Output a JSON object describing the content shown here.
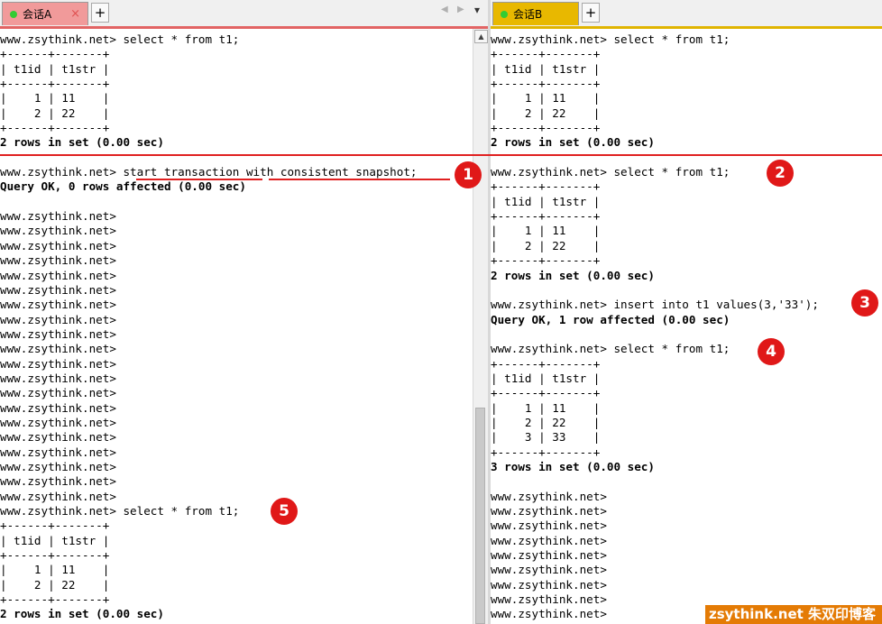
{
  "tabs": {
    "a": {
      "label": "会话A",
      "close": "×",
      "add": "+"
    },
    "b": {
      "label": "会话B",
      "add": "+"
    },
    "nav_prev": "◀",
    "nav_next": "▶",
    "nav_menu": "▾"
  },
  "session_a": {
    "lines": [
      "www.zsythink.net> select * from t1;",
      "+------+-------+",
      "| t1id | t1str |",
      "+------+-------+",
      "|    1 | 11    |",
      "|    2 | 22    |",
      "+------+-------+",
      "2 rows in set (0.00 sec)",
      "",
      "www.zsythink.net> start transaction with consistent snapshot;",
      "Query OK, 0 rows affected (0.00 sec)",
      "",
      "www.zsythink.net>",
      "www.zsythink.net>",
      "www.zsythink.net>",
      "www.zsythink.net>",
      "www.zsythink.net>",
      "www.zsythink.net>",
      "www.zsythink.net>",
      "www.zsythink.net>",
      "www.zsythink.net>",
      "www.zsythink.net>",
      "www.zsythink.net>",
      "www.zsythink.net>",
      "www.zsythink.net>",
      "www.zsythink.net>",
      "www.zsythink.net>",
      "www.zsythink.net>",
      "www.zsythink.net>",
      "www.zsythink.net>",
      "www.zsythink.net>",
      "www.zsythink.net>",
      "www.zsythink.net> select * from t1;",
      "+------+-------+",
      "| t1id | t1str |",
      "+------+-------+",
      "|    1 | 11    |",
      "|    2 | 22    |",
      "+------+-------+",
      "2 rows in set (0.00 sec)"
    ]
  },
  "session_b": {
    "lines": [
      "www.zsythink.net> select * from t1;",
      "+------+-------+",
      "| t1id | t1str |",
      "+------+-------+",
      "|    1 | 11    |",
      "|    2 | 22    |",
      "+------+-------+",
      "2 rows in set (0.00 sec)",
      "",
      "www.zsythink.net> select * from t1;",
      "+------+-------+",
      "| t1id | t1str |",
      "+------+-------+",
      "|    1 | 11    |",
      "|    2 | 22    |",
      "+------+-------+",
      "2 rows in set (0.00 sec)",
      "",
      "www.zsythink.net> insert into t1 values(3,'33');",
      "Query OK, 1 row affected (0.00 sec)",
      "",
      "www.zsythink.net> select * from t1;",
      "+------+-------+",
      "| t1id | t1str |",
      "+------+-------+",
      "|    1 | 11    |",
      "|    2 | 22    |",
      "|    3 | 33    |",
      "+------+-------+",
      "3 rows in set (0.00 sec)",
      "",
      "www.zsythink.net>",
      "www.zsythink.net>",
      "www.zsythink.net>",
      "www.zsythink.net>",
      "www.zsythink.net>",
      "www.zsythink.net>",
      "www.zsythink.net>",
      "www.zsythink.net>",
      "www.zsythink.net>",
      "www.zsythink.net>"
    ]
  },
  "annotations": {
    "step1": "1",
    "step2": "2",
    "step3": "3",
    "step4": "4",
    "step5": "5"
  },
  "scrollbar": {
    "up_arrow": "▲"
  },
  "watermark": "zsythink.net 朱双印博客",
  "colors": {
    "tab_a": "#f19a9a",
    "tab_b": "#e8b800",
    "annotation_red": "#e01818",
    "watermark_bg": "#e47b05"
  }
}
